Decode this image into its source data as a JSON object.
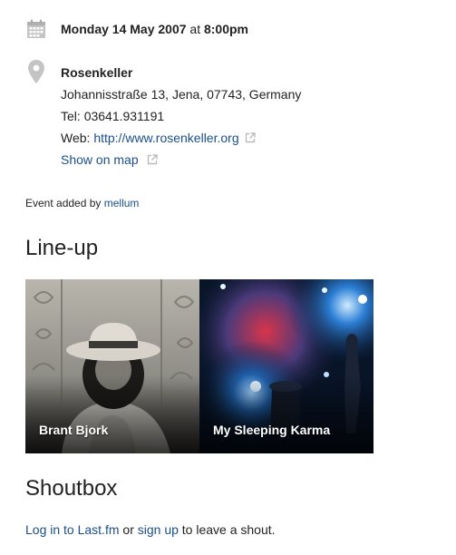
{
  "event": {
    "date_text": "Monday 14 May 2007",
    "at_text": " at ",
    "time_text": "8:00pm"
  },
  "venue": {
    "name": "Rosenkeller",
    "address": "Johannisstraße 13, Jena, 07743, Germany",
    "tel_label": "Tel: ",
    "tel_value": "03641.931191",
    "web_label": "Web: ",
    "web_url": "http://www.rosenkeller.org",
    "map_link": "Show on map"
  },
  "added_by": {
    "prefix": "Event added by ",
    "user": "mellum"
  },
  "lineup": {
    "title": "Line-up",
    "artists": [
      {
        "name": "Brant Bjork"
      },
      {
        "name": "My Sleeping Karma"
      }
    ]
  },
  "shoutbox": {
    "title": "Shoutbox",
    "login_link": "Log in to Last.fm",
    "or_text": " or ",
    "signup_link": "sign up",
    "suffix": " to leave a shout."
  },
  "colors": {
    "link": "#1a4f8b",
    "icon_grey": "#bbbbbb",
    "text": "#222222"
  },
  "icons": {
    "date": "calendar-icon",
    "venue": "map-pin-icon",
    "external": "external-link-icon"
  }
}
